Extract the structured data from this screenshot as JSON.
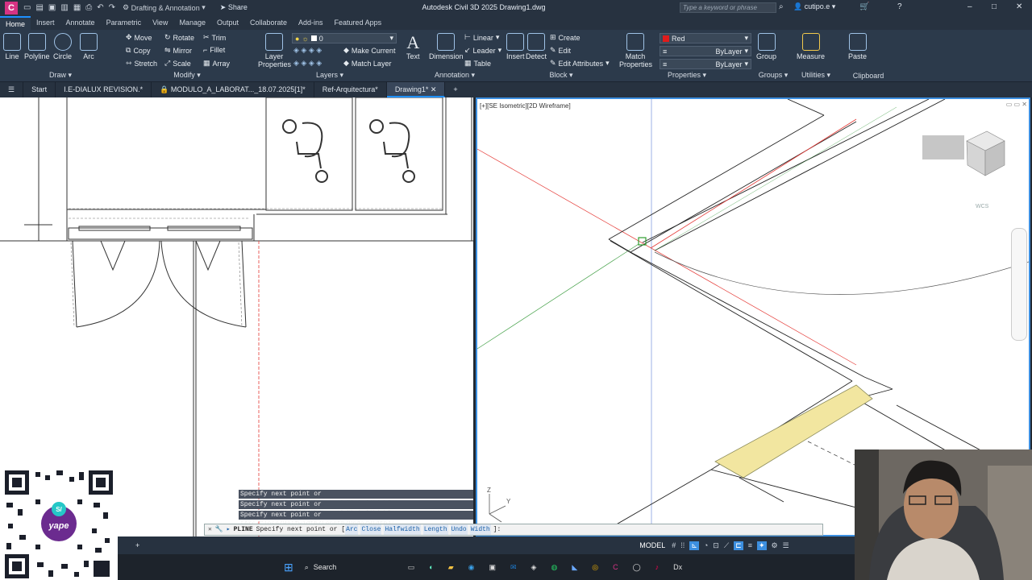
{
  "titlebar": {
    "logo_letter": "C",
    "workspace": "Drafting & Annotation",
    "share_label": "Share",
    "app_title": "Autodesk Civil 3D 2025   Drawing1.dwg",
    "search_placeholder": "Type a keyword or phrase",
    "user_name": "cutipo.e"
  },
  "ribbon_tabs": [
    "Home",
    "Insert",
    "Annotate",
    "Parametric",
    "View",
    "Manage",
    "Output",
    "Collaborate",
    "Add-ins",
    "Featured Apps"
  ],
  "ribbon": {
    "draw": {
      "title": "Draw",
      "line": "Line",
      "polyline": "Polyline",
      "circle": "Circle",
      "arc": "Arc"
    },
    "modify": {
      "title": "Modify",
      "move": "Move",
      "rotate": "Rotate",
      "trim": "Trim",
      "copy": "Copy",
      "mirror": "Mirror",
      "fillet": "Fillet",
      "stretch": "Stretch",
      "scale": "Scale",
      "array": "Array"
    },
    "layers": {
      "title": "Layers",
      "layer_properties": "Layer Properties",
      "current_layer": "0",
      "make_current": "Make Current",
      "match_layer": "Match Layer"
    },
    "annotation": {
      "title": "Annotation",
      "text": "Text",
      "dimension": "Dimension",
      "linear": "Linear",
      "leader": "Leader",
      "table": "Table"
    },
    "block": {
      "title": "Block",
      "insert": "Insert",
      "detect": "Detect",
      "create": "Create",
      "edit": "Edit",
      "edit_attributes": "Edit Attributes"
    },
    "properties": {
      "title": "Properties",
      "match_properties": "Match Properties",
      "color": "Red",
      "color_hex": "#e01c1c",
      "linetype": "ByLayer",
      "lineweight": "ByLayer"
    },
    "groups": {
      "title": "Groups",
      "group": "Group"
    },
    "utilities": {
      "title": "Utilities",
      "measure": "Measure"
    },
    "clipboard": {
      "title": "Clipboard",
      "paste": "Paste"
    }
  },
  "doc_tabs": [
    "Start",
    "I.E-DIALUX REVISION.*",
    "MODULO_A_LABORAT..._18.07.2025[1]*",
    "Ref-Arquitectura*",
    "Drawing1*"
  ],
  "viewport": {
    "label": "[+][SE Isometric][2D Wireframe]",
    "wcs": "WCS"
  },
  "command": {
    "history": [
      "Specify next point or [Arc/Close/Halfwidth/Length/Undo/Width]:",
      "Specify next point or [Arc/Close/Halfwidth/Length/Undo/Width]:",
      "Specify next point or [Arc/Close/Halfwidth/Length/Undo/Width]:"
    ],
    "name": "PLINE",
    "prompt": "Specify next point or [",
    "options": [
      "Arc",
      "Close",
      "Halfwidth",
      "Length",
      "Undo",
      "Width"
    ],
    "suffix": "]:"
  },
  "status": {
    "model": "MODEL"
  },
  "taskbar": {
    "search": "Search"
  },
  "colors": {
    "accent": "#1e90ff",
    "drawing_red": "#e53935",
    "drawing_green": "#43a047",
    "tactile_yellow": "#f2e6a0"
  }
}
